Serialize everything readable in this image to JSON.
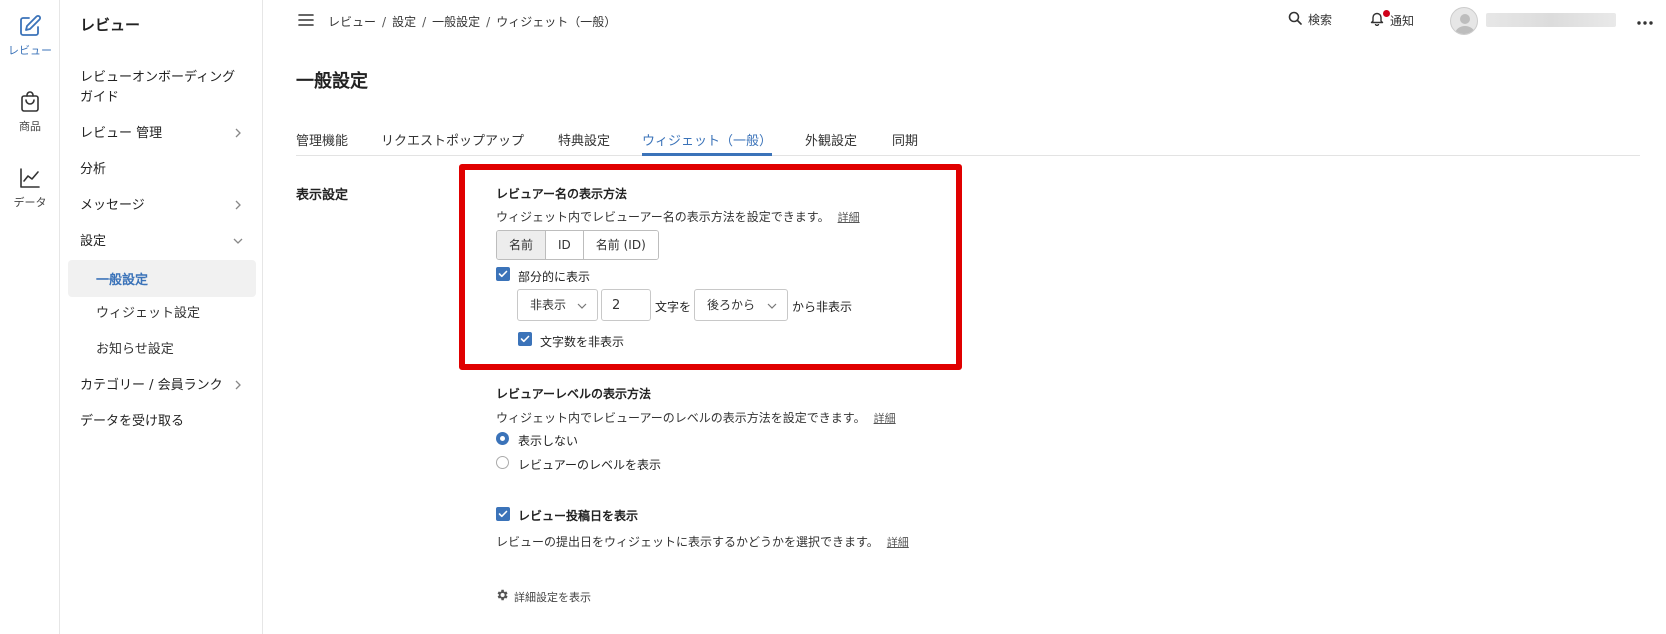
{
  "rail": {
    "items": [
      {
        "label": "レビュー",
        "icon": "edit-icon",
        "active": true
      },
      {
        "label": "商品",
        "icon": "shopping-bag-icon"
      },
      {
        "label": "データ",
        "icon": "chart-icon"
      }
    ]
  },
  "sidebar": {
    "title": "レビュー",
    "items": [
      {
        "label": "レビューオンボーディング"
      },
      {
        "label": "ガイド"
      },
      {
        "label": "レビュー 管理"
      },
      {
        "label": "分析"
      },
      {
        "label": "メッセージ"
      },
      {
        "label": "設定"
      },
      {
        "label": "カテゴリー / 会員ランク"
      },
      {
        "label": "データを受け取る"
      }
    ],
    "sub_items": [
      {
        "label": "一般設定"
      },
      {
        "label": "ウィジェット設定"
      },
      {
        "label": "お知らせ設定"
      }
    ]
  },
  "topbar": {
    "breadcrumb": [
      "レビュー",
      "設定",
      "一般設定",
      "ウィジェット（一般）"
    ],
    "search_label": "検索",
    "notify_label": "通知",
    "accent": "#3b73b9",
    "notify_dot_color": "#d0021b"
  },
  "main": {
    "page_title": "一般設定",
    "tabs": [
      {
        "label": "管理機能"
      },
      {
        "label": "リクエストポップアップ"
      },
      {
        "label": "特典設定"
      },
      {
        "label": "ウィジェット（一般）",
        "active": true
      },
      {
        "label": "外観設定"
      },
      {
        "label": "同期"
      }
    ],
    "section_label": "表示設定",
    "reviewer_name": {
      "title": "レビュアー名の表示方法",
      "description": "ウィジェット内でレビューアー名の表示方法を設定できます。",
      "detail_link": "詳細",
      "segments": [
        "名前",
        "ID",
        "名前 (ID)"
      ],
      "selected_segment": "名前",
      "partial_label": "部分的に表示",
      "partial_checked": true,
      "mode_select": "非表示",
      "char_count": "2",
      "chars_text": "文字を",
      "direction_select": "後ろから",
      "suffix_text": "から非表示",
      "hide_count_label": "文字数を非表示",
      "hide_count_checked": true
    },
    "reviewer_level": {
      "title": "レビュアーレベルの表示方法",
      "description": "ウィジェット内でレビューアーのレベルの表示方法を設定できます。",
      "detail_link": "詳細",
      "options": [
        "表示しない",
        "レビュアーのレベルを表示"
      ],
      "selected": "表示しない"
    },
    "post_date": {
      "label": "レビュー投稿日を表示",
      "checked": true,
      "description": "レビューの提出日をウィジェットに表示するかどうかを選択できます。",
      "detail_link": "詳細"
    },
    "advanced_label": "詳細設定を表示",
    "highlight_color": "#e00000"
  }
}
